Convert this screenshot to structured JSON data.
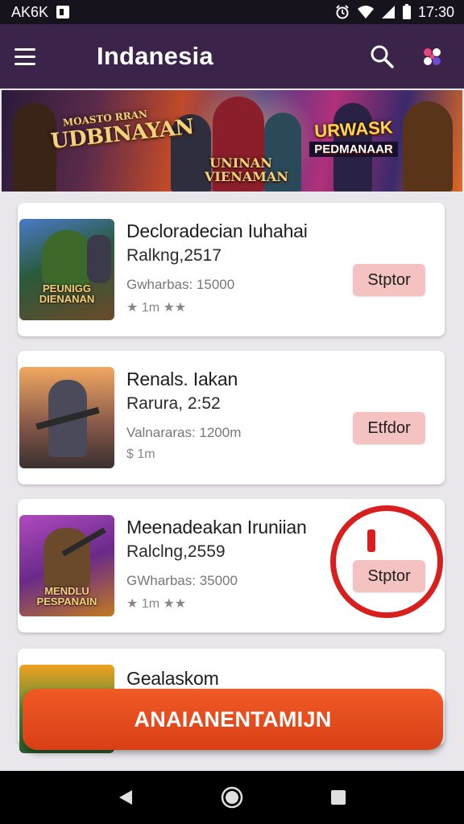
{
  "status_bar": {
    "left_text": "AK6K",
    "time": "17:30"
  },
  "app_bar": {
    "title": "Indanesia",
    "menu_icon": "menu-icon",
    "search_icon": "search-icon",
    "apps_icon": "apps-icon"
  },
  "banner": {
    "left_small": "MOASTO RRAN",
    "left_big": "UDBINAYAN",
    "mid_text": "UNINAN VIENAMAN",
    "right_big": "URWASK",
    "right_small": "PEDMANAAR"
  },
  "items": [
    {
      "title": "Decloradecian Iuhahai",
      "rank": "Ralkng,2517",
      "meta": "Gwharbas: 15000",
      "rating": "★ 1m  ★★",
      "button": "Stptor",
      "thumb_label": "PEUNIGG DIENANAN"
    },
    {
      "title": "Renals. Iakan",
      "rank": "Rarura, 2:52",
      "meta": "Valnararas: 1200m",
      "rating": "$ 1m",
      "button": "Etfdor",
      "thumb_label": ""
    },
    {
      "title": "Meenadeakan Iruniian",
      "rank": "Ralclng,2559",
      "meta": "GWharbas: 35000",
      "rating": "★ 1m  ★★",
      "button": "Stptor",
      "thumb_label": "MENDLU PESPANAIN"
    },
    {
      "title": "Gealaskom",
      "rank": "",
      "meta": "",
      "rating": "",
      "button": "",
      "thumb_label": ""
    }
  ],
  "cta": {
    "label": "ANAIANENTAMIJN"
  },
  "colors": {
    "app_bar": "#3b2349",
    "cta": "#e84a1d",
    "button": "#f5c2c2",
    "ring": "#d91e1e"
  }
}
